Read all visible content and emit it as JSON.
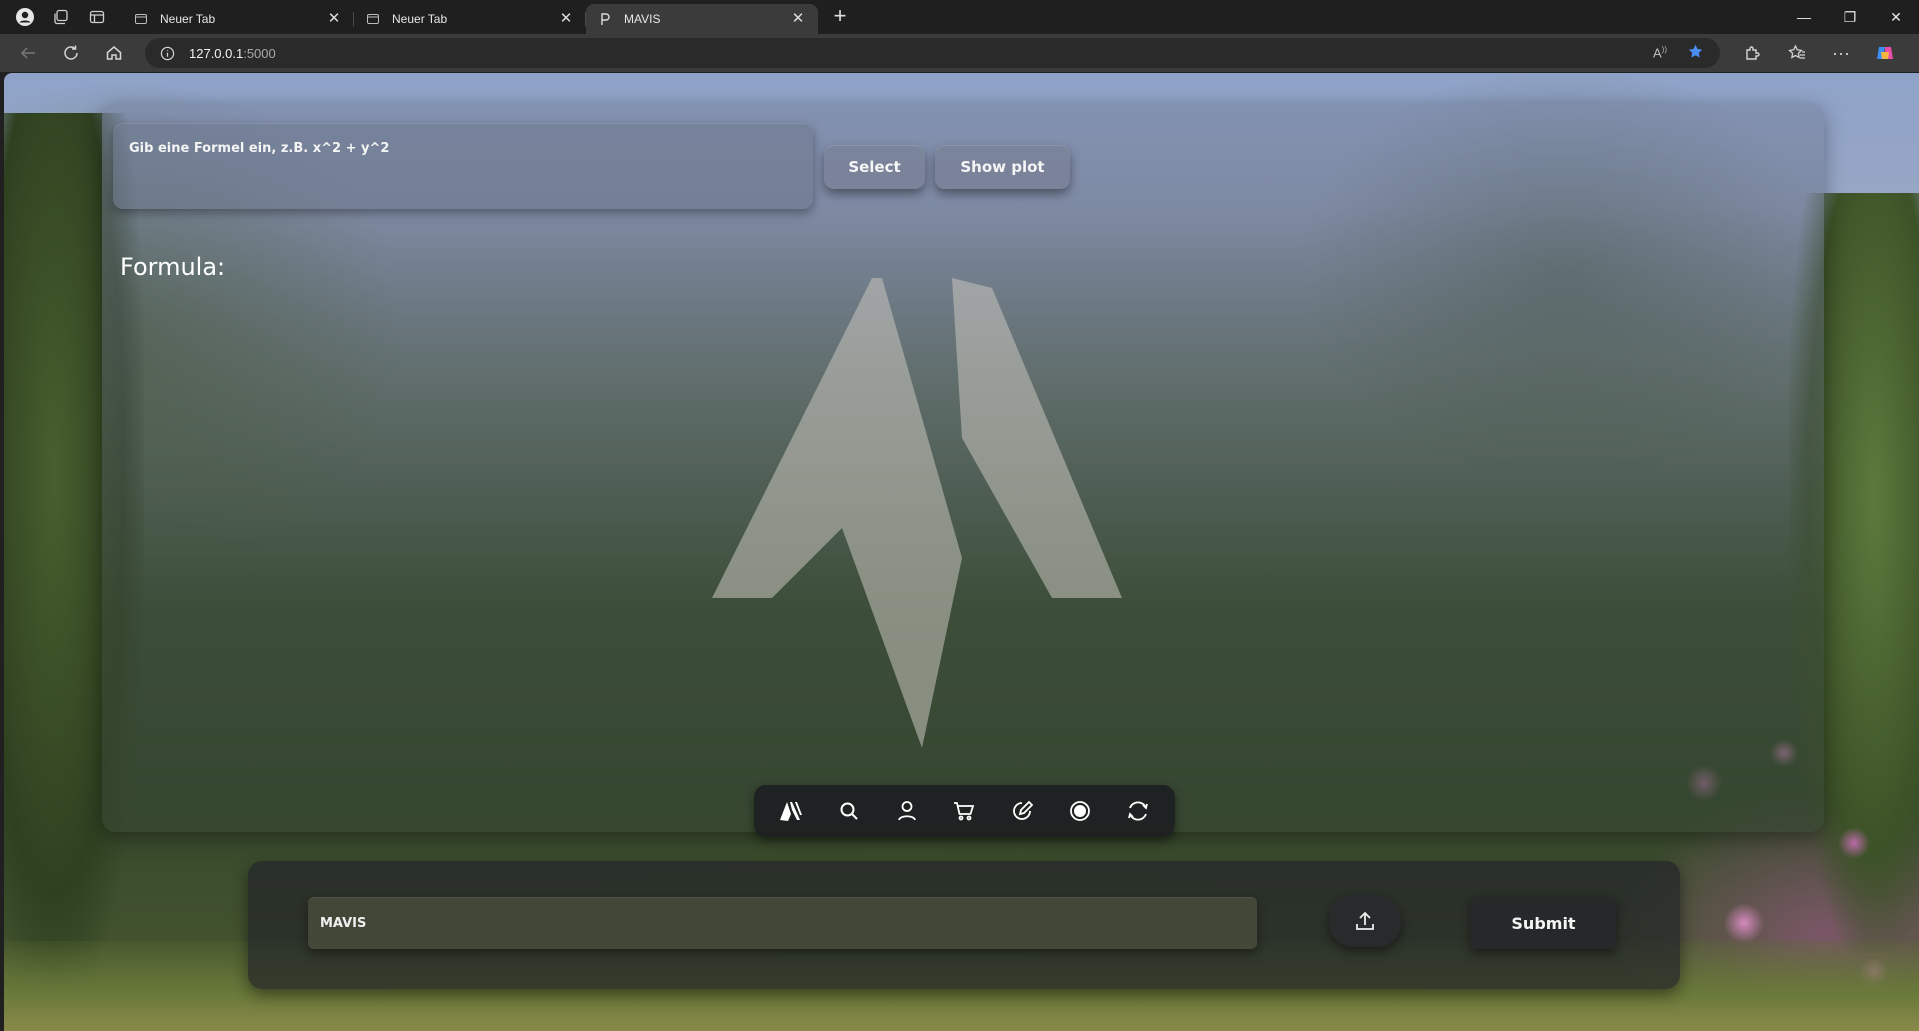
{
  "browser": {
    "tabs": [
      {
        "title": "Neuer Tab",
        "active": false
      },
      {
        "title": "Neuer Tab",
        "active": false
      },
      {
        "title": "MAVIS",
        "active": true
      }
    ],
    "url_host": "127.0.0.1",
    "url_port": ":5000"
  },
  "page": {
    "formula_placeholder": "Gib eine Formel ein, z.B. x^2 + y^2",
    "select_label": "Select",
    "show_plot_label": "Show plot",
    "formula_label": "Formula:",
    "dock_items": [
      "mavis-logo-icon",
      "search-icon",
      "user-icon",
      "cart-icon",
      "edit-icon",
      "record-icon",
      "sync-icon"
    ],
    "chat_placeholder": "MAVIS",
    "submit_label": "Submit"
  },
  "colors": {
    "accent_star": "#4a8df0"
  }
}
